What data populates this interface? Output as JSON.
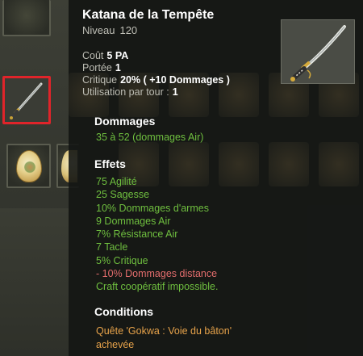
{
  "item": {
    "name": "Katana de la Tempête",
    "level_label": "Niveau",
    "level_value": "120"
  },
  "stats": {
    "cost_label": "Coût",
    "cost_value": "5 PA",
    "range_label": "Portée",
    "range_value": "1",
    "crit_label": "Critique",
    "crit_value": "20% ( +10 Dommages )",
    "uses_label": "Utilisation par tour :",
    "uses_value": "1"
  },
  "damage": {
    "title": "Dommages",
    "line": "35 à 52 (dommages Air)"
  },
  "effects": {
    "title": "Effets",
    "lines": [
      {
        "bold": "75",
        "text": " Agilité",
        "kind": "pos"
      },
      {
        "bold": "25",
        "text": " Sagesse",
        "kind": "pos"
      },
      {
        "bold": "10%",
        "text": " Dommages d'armes",
        "kind": "pos"
      },
      {
        "bold": "9",
        "text": " Dommages Air",
        "kind": "pos"
      },
      {
        "bold": "7%",
        "text": " Résistance Air",
        "kind": "pos"
      },
      {
        "bold": "7",
        "text": " Tacle",
        "kind": "pos"
      },
      {
        "bold": "5%",
        "text": " Critique",
        "kind": "pos"
      },
      {
        "bold": "- 10%",
        "text": " Dommages distance",
        "kind": "neg"
      },
      {
        "bold": "",
        "text": "Craft coopératif impossible.",
        "kind": "pos"
      }
    ]
  },
  "conditions": {
    "title": "Conditions",
    "line1": "Quête 'Gokwa : Voie du bâton'",
    "line2": "achevée"
  },
  "icons": {
    "item_image": "katana-icon",
    "inventory_weapon": "katana-icon",
    "inventory_egg": "egg-icon"
  },
  "colors": {
    "selection_border": "#e0242a",
    "positive_effect": "#6fbf3f",
    "negative_effect": "#e36d6d",
    "condition_text": "#e6a24a"
  }
}
